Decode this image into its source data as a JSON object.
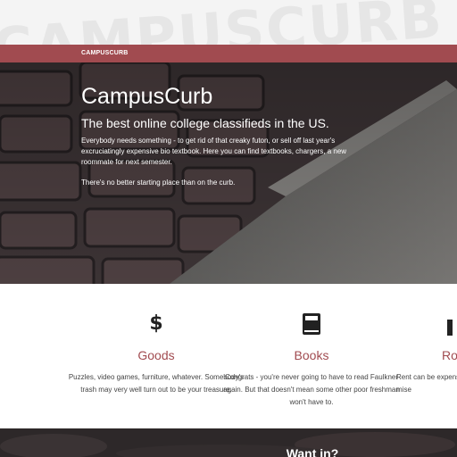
{
  "watermark": "CAMPUSCURB CAMPUSCURB",
  "navbar": {
    "brand": "CAMPUSCURB"
  },
  "hero": {
    "title": "CampusCurb",
    "subtitle": "The best online college classifieds in the US.",
    "paragraph1": "Everybody needs something - to get rid of that creaky futon, or sell off last year's excruciatingly expensive bio textbook. Here you can find textbooks, chargers, a new roommate for next semester.",
    "paragraph2": "There's no better starting place than on the curb."
  },
  "features": [
    {
      "icon": "$",
      "title": "Goods",
      "description": "Puzzles, video games, furniture, whatever. Somebody's trash may very well turn out to be your treasure."
    },
    {
      "icon": "book-icon",
      "title": "Books",
      "description": "Congrats - you're never going to have to read Faulkner again. But that doesn't mean some other poor freshman won't have to."
    },
    {
      "icon": "R",
      "title": "Ro",
      "description": "Rent can be expens wallow in mise"
    }
  ],
  "bottom": {
    "title": "Want in?"
  },
  "colors": {
    "accent": "#a14b50",
    "hero_bg": "#3a3436",
    "text_dark": "#444444"
  }
}
